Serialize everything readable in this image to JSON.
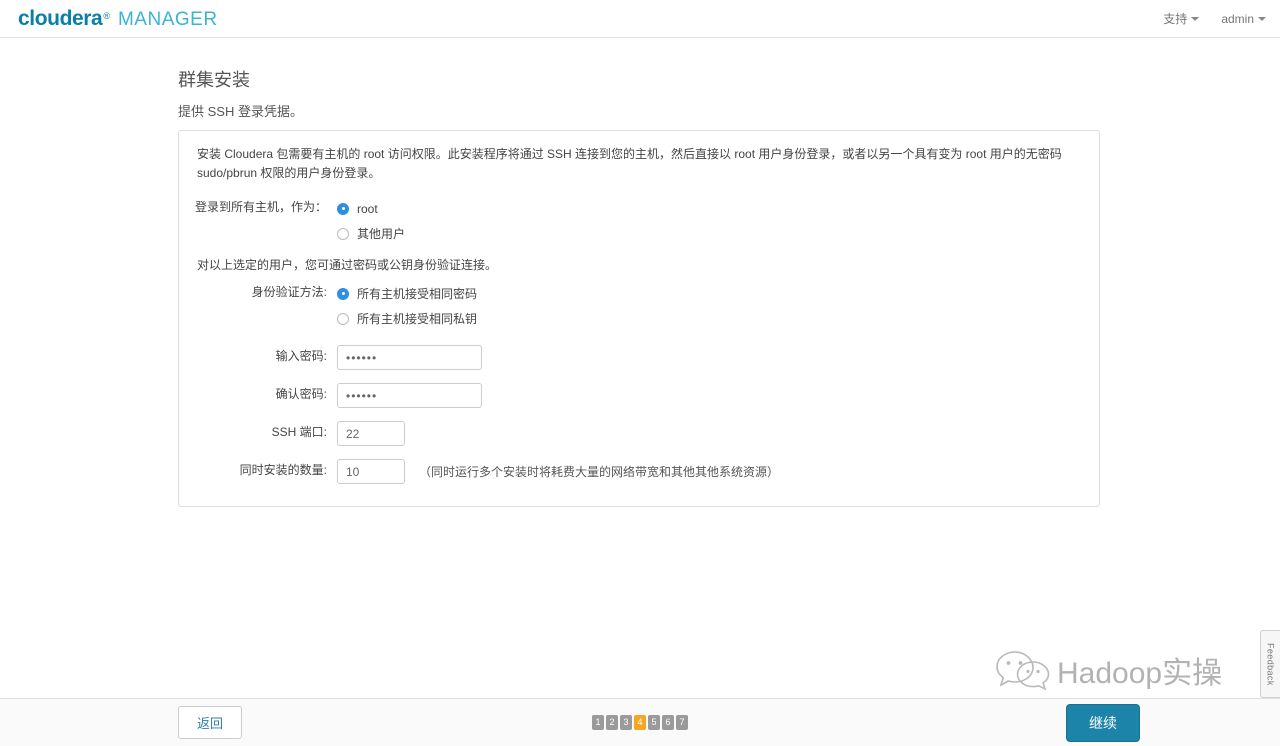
{
  "header": {
    "brand_primary": "cloudera",
    "brand_reg": "®",
    "brand_secondary": "MANAGER",
    "support_label": "支持",
    "user_label": "admin"
  },
  "wizard": {
    "title": "群集安装",
    "subtitle": "提供 SSH 登录凭据。"
  },
  "panel": {
    "description": "安装 Cloudera 包需要有主机的 root 访问权限。此安装程序将通过 SSH 连接到您的主机，然后直接以 root 用户身份登录，或者以另一个具有变为 root 用户的无密码 sudo/pbrun 权限的用户身份登录。",
    "login_as": {
      "label": "登录到所有主机，作为：",
      "options": [
        {
          "label": "root",
          "checked": true
        },
        {
          "label": "其他用户",
          "checked": false
        }
      ]
    },
    "auth_note": "对以上选定的用户，您可通过密码或公钥身份验证连接。",
    "auth_method": {
      "label": "身份验证方法:",
      "options": [
        {
          "label": "所有主机接受相同密码",
          "checked": true
        },
        {
          "label": "所有主机接受相同私钥",
          "checked": false
        }
      ]
    },
    "fields": {
      "password": {
        "label": "输入密码:",
        "value": "••••••"
      },
      "confirm_password": {
        "label": "确认密码:",
        "value": "••••••"
      },
      "ssh_port": {
        "label": "SSH 端口:",
        "value": "22"
      },
      "concurrent": {
        "label": "同时安装的数量:",
        "value": "10",
        "hint": "（同时运行多个安装时将耗费大量的网络带宽和其他其他系统资源）"
      }
    }
  },
  "watermark": {
    "icon": "wechat-icon",
    "text": "Hadoop实操"
  },
  "feedback": {
    "label": "Feedback"
  },
  "footer": {
    "back_label": "返回",
    "continue_label": "继续",
    "steps": [
      "1",
      "2",
      "3",
      "4",
      "5",
      "6",
      "7"
    ],
    "active_step": 4
  },
  "colors": {
    "brand_dark": "#0a7fa8",
    "brand_light": "#3ab3d4",
    "radio_checked": "#2f8fe0",
    "step_active": "#f5a623",
    "step_inactive": "#9a9a9a",
    "continue_button": "#1b84a8",
    "back_button_text": "#2f7f9e"
  }
}
